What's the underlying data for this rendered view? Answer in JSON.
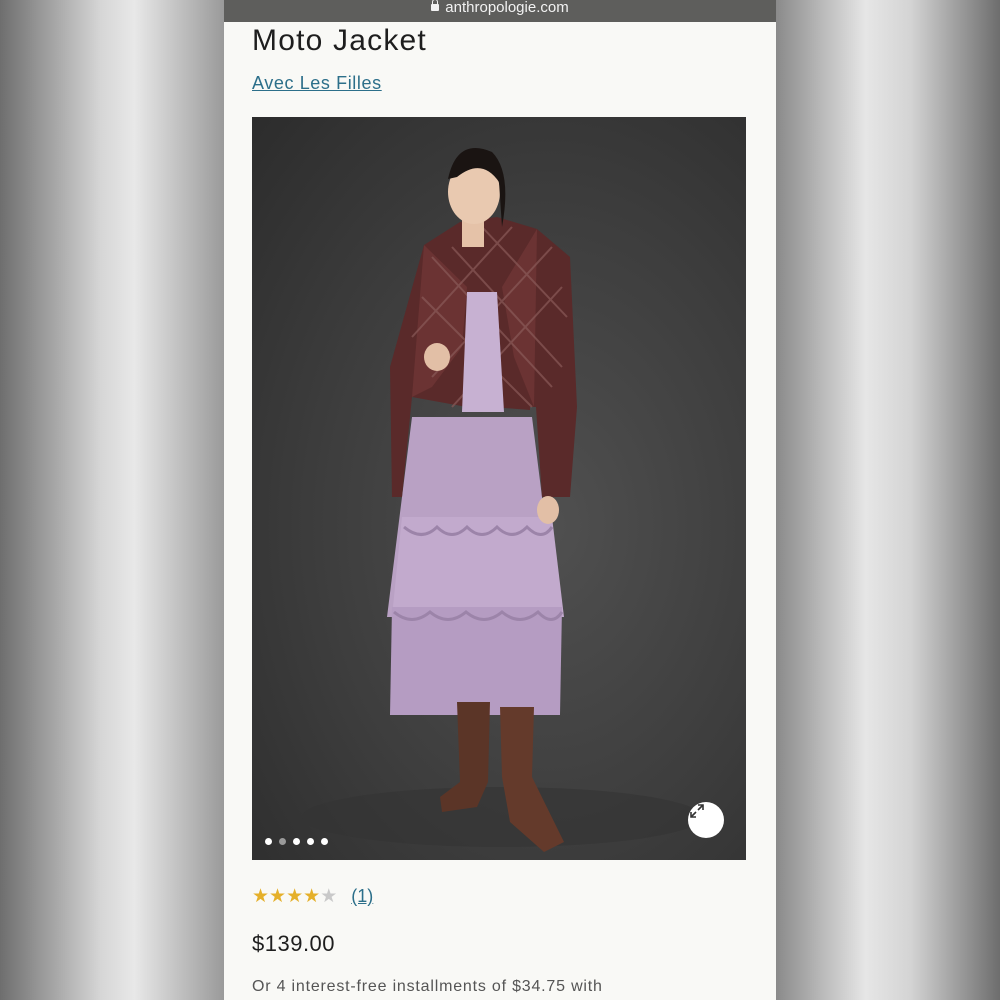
{
  "browser": {
    "url": "anthropologie.com"
  },
  "product": {
    "title": "Moto Jacket",
    "brand": "Avec Les Filles",
    "rating": {
      "value": 4,
      "max": 5,
      "review_count_label": "(1)"
    },
    "price": "$139.00",
    "installments_text": "Or 4 interest-free installments of $34.75 with"
  },
  "gallery": {
    "image_count": 5,
    "active_index": 1,
    "expand_icon": "expand-arrows-icon"
  },
  "colors": {
    "link": "#2c6f8a",
    "star": "#e5b02a",
    "page_bg": "#f9f9f6"
  }
}
